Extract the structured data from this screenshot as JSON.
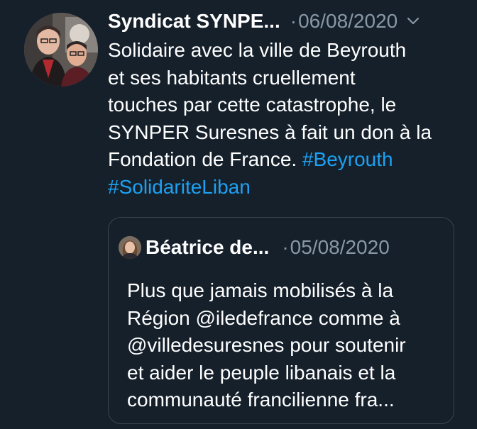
{
  "tweet": {
    "avatar_icon": "profile-photo",
    "author_name": "Syndicat SYNPE...",
    "separator": "·",
    "date": "06/08/2020",
    "menu_icon": "chevron-down-icon",
    "text_lines": [
      "Solidaire avec la ville de Beyrouth",
      "et ses habitants cruellement",
      "touches par cette catastrophe, le",
      "SYNPER Suresnes à fait un don à la",
      "Fondation de France. "
    ],
    "hashtags": [
      "#Beyrouth",
      "#SolidariteLiban"
    ],
    "hashtag_color": "#1da1f2"
  },
  "quoted": {
    "avatar_icon": "profile-photo",
    "author_name": "Béatrice de...",
    "separator": "·",
    "date": "05/08/2020",
    "text_lines": [
      "Plus que jamais mobilisés à la",
      "Région @iledefrance comme à",
      "@villedesuresnes pour soutenir",
      "et aider le peuple libanais et la",
      "communauté francilienne fra..."
    ]
  },
  "colors": {
    "background": "#15202b",
    "secondary_text": "#8899a6",
    "border": "#38444d"
  }
}
